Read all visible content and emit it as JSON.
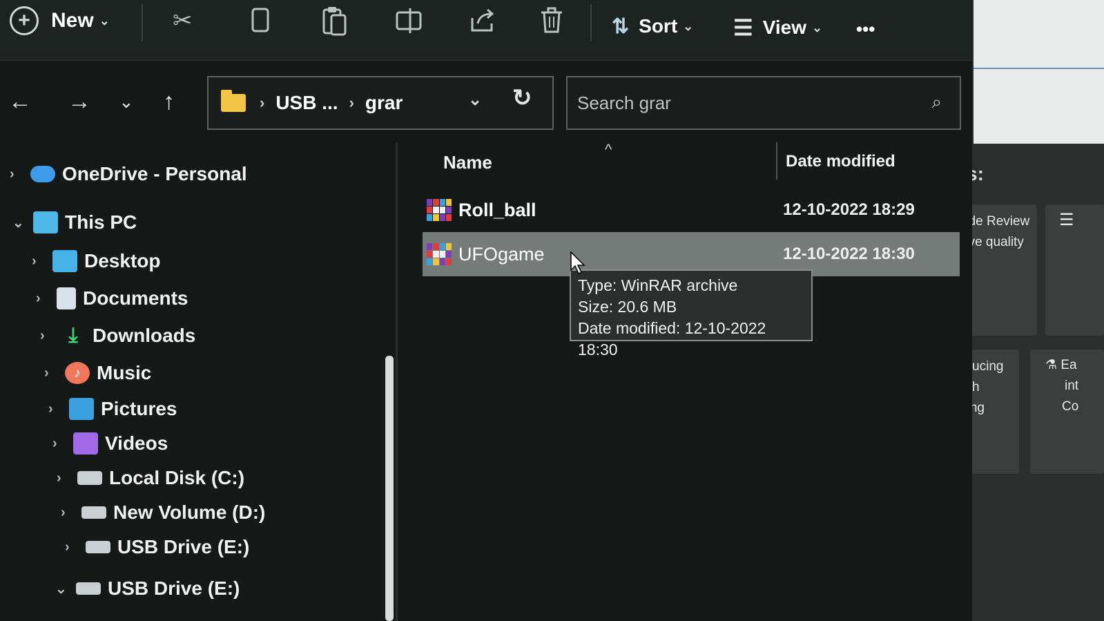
{
  "toolbar": {
    "new_label": "New",
    "sort_label": "Sort",
    "view_label": "View",
    "more_label": "•••"
  },
  "address": {
    "crumbs": [
      "USB ...",
      "grar"
    ]
  },
  "search": {
    "placeholder": "Search grar"
  },
  "tree": [
    {
      "label": "OneDrive - Personal",
      "expanded": false
    },
    {
      "label": "This PC",
      "expanded": true
    },
    {
      "label": "Desktop"
    },
    {
      "label": "Documents"
    },
    {
      "label": "Downloads"
    },
    {
      "label": "Music"
    },
    {
      "label": "Pictures"
    },
    {
      "label": "Videos"
    },
    {
      "label": "Local Disk (C:)"
    },
    {
      "label": "New Volume (D:)"
    },
    {
      "label": "USB Drive (E:)"
    },
    {
      "label": "USB Drive (E:)",
      "expanded": true
    }
  ],
  "columns": {
    "name": "Name",
    "date": "Date modified"
  },
  "files": [
    {
      "name": "Roll_ball",
      "date": "12-10-2022 18:29",
      "selected": false
    },
    {
      "name": "UFOgame",
      "date": "12-10-2022 18:30",
      "selected": true
    }
  ],
  "tooltip": {
    "type": "Type: WinRAR archive",
    "size": "Size: 20.6 MB",
    "date": "Date modified: 12-10-2022 18:30"
  },
  "background_window": {
    "heading": "s:",
    "card1": [
      "ode Review",
      "ove quality"
    ],
    "card2": [
      "producing",
      "rough",
      "testing"
    ],
    "card3": [
      "Ea",
      "int",
      "Co"
    ]
  },
  "colors": {
    "selected_row": "#757b79",
    "folder": "#f3c545",
    "onedrive": "#3d9be9"
  }
}
